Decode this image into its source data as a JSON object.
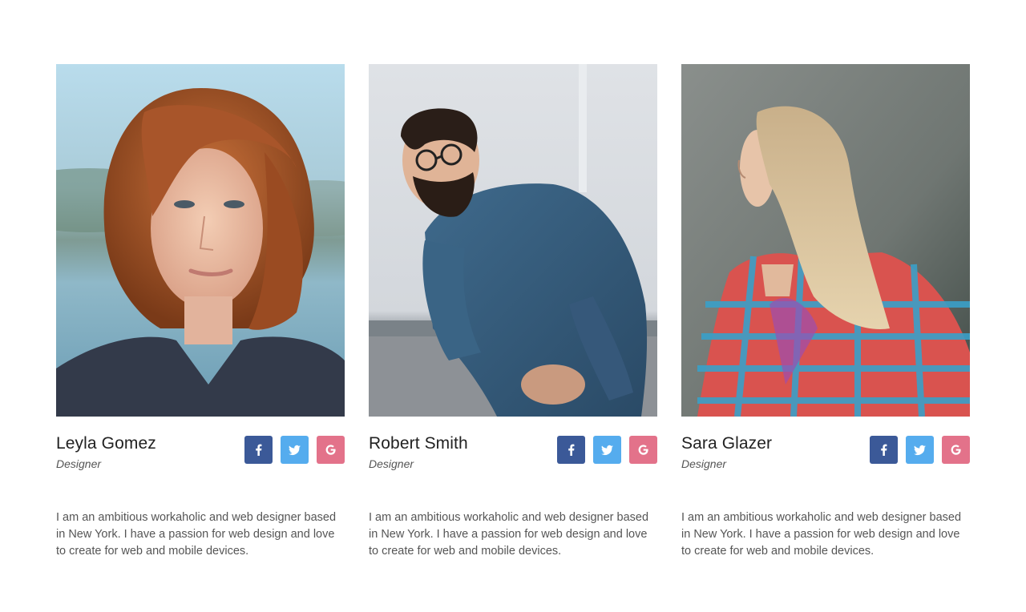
{
  "colors": {
    "facebook": "#3b5998",
    "twitter": "#55acee",
    "google": "#e3728a",
    "name_text": "#222222",
    "body_text": "#555555"
  },
  "members": [
    {
      "name": "Leyla Gomez",
      "role": "Designer",
      "bio": "I am an ambitious workaholic and web designer based in New York. I have a passion for web design and love to create for web and mobile devices.",
      "icons": [
        "facebook-icon",
        "twitter-icon",
        "google-icon"
      ]
    },
    {
      "name": "Robert Smith",
      "role": "Designer",
      "bio": "I am an ambitious workaholic and web designer based in New York. I have a passion for web design and love to create for web and mobile devices.",
      "icons": [
        "facebook-icon",
        "twitter-icon",
        "google-icon"
      ]
    },
    {
      "name": "Sara Glazer",
      "role": "Designer",
      "bio": "I am an ambitious workaholic and web designer based in New York. I have a passion for web design and love to create for web and mobile devices.",
      "icons": [
        "facebook-icon",
        "twitter-icon",
        "google-icon"
      ]
    }
  ]
}
